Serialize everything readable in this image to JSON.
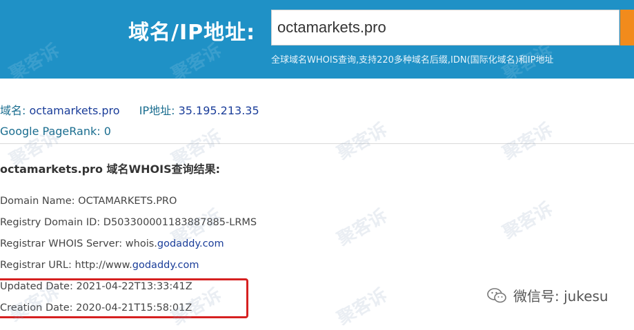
{
  "header": {
    "label": "域名/IP地址:",
    "search_value": "octamarkets.pro",
    "description": "全球域名WHOIS查询,支持220多种域名后缀,IDN(国际化域名)和IP地址",
    "background_color": "#1f91c6",
    "button_color": "#f28b1c"
  },
  "info": {
    "domain_label": "域名:",
    "domain_value": "octamarkets.pro",
    "ip_label": "IP地址:",
    "ip_value": "35.195.213.35",
    "pagerank_label": "Google PageRank:",
    "pagerank_value": "0"
  },
  "result_title": "octamarkets.pro 域名WHOIS查询结果:",
  "records": [
    {
      "label": "Domain Name:",
      "value": "OCTAMARKETS.PRO"
    },
    {
      "label": "Registry Domain ID:",
      "value": "D503300001183887885-LRMS"
    },
    {
      "label": "Registrar WHOIS Server:",
      "value_prefix": "whois.",
      "value_link": "godaddy.com"
    },
    {
      "label": "Registrar URL:",
      "value_prefix": "http://www.",
      "value_link": "godaddy.com"
    },
    {
      "label": "Updated Date:",
      "value": "2021-04-22T13:33:41Z"
    },
    {
      "label": "Creation Date:",
      "value": "2020-04-21T15:58:01Z"
    }
  ],
  "highlight_color": "#d62020",
  "watermark_text": "聚客诉",
  "wechat": {
    "icon": "wechat-icon",
    "text": "微信号: jukesu"
  }
}
